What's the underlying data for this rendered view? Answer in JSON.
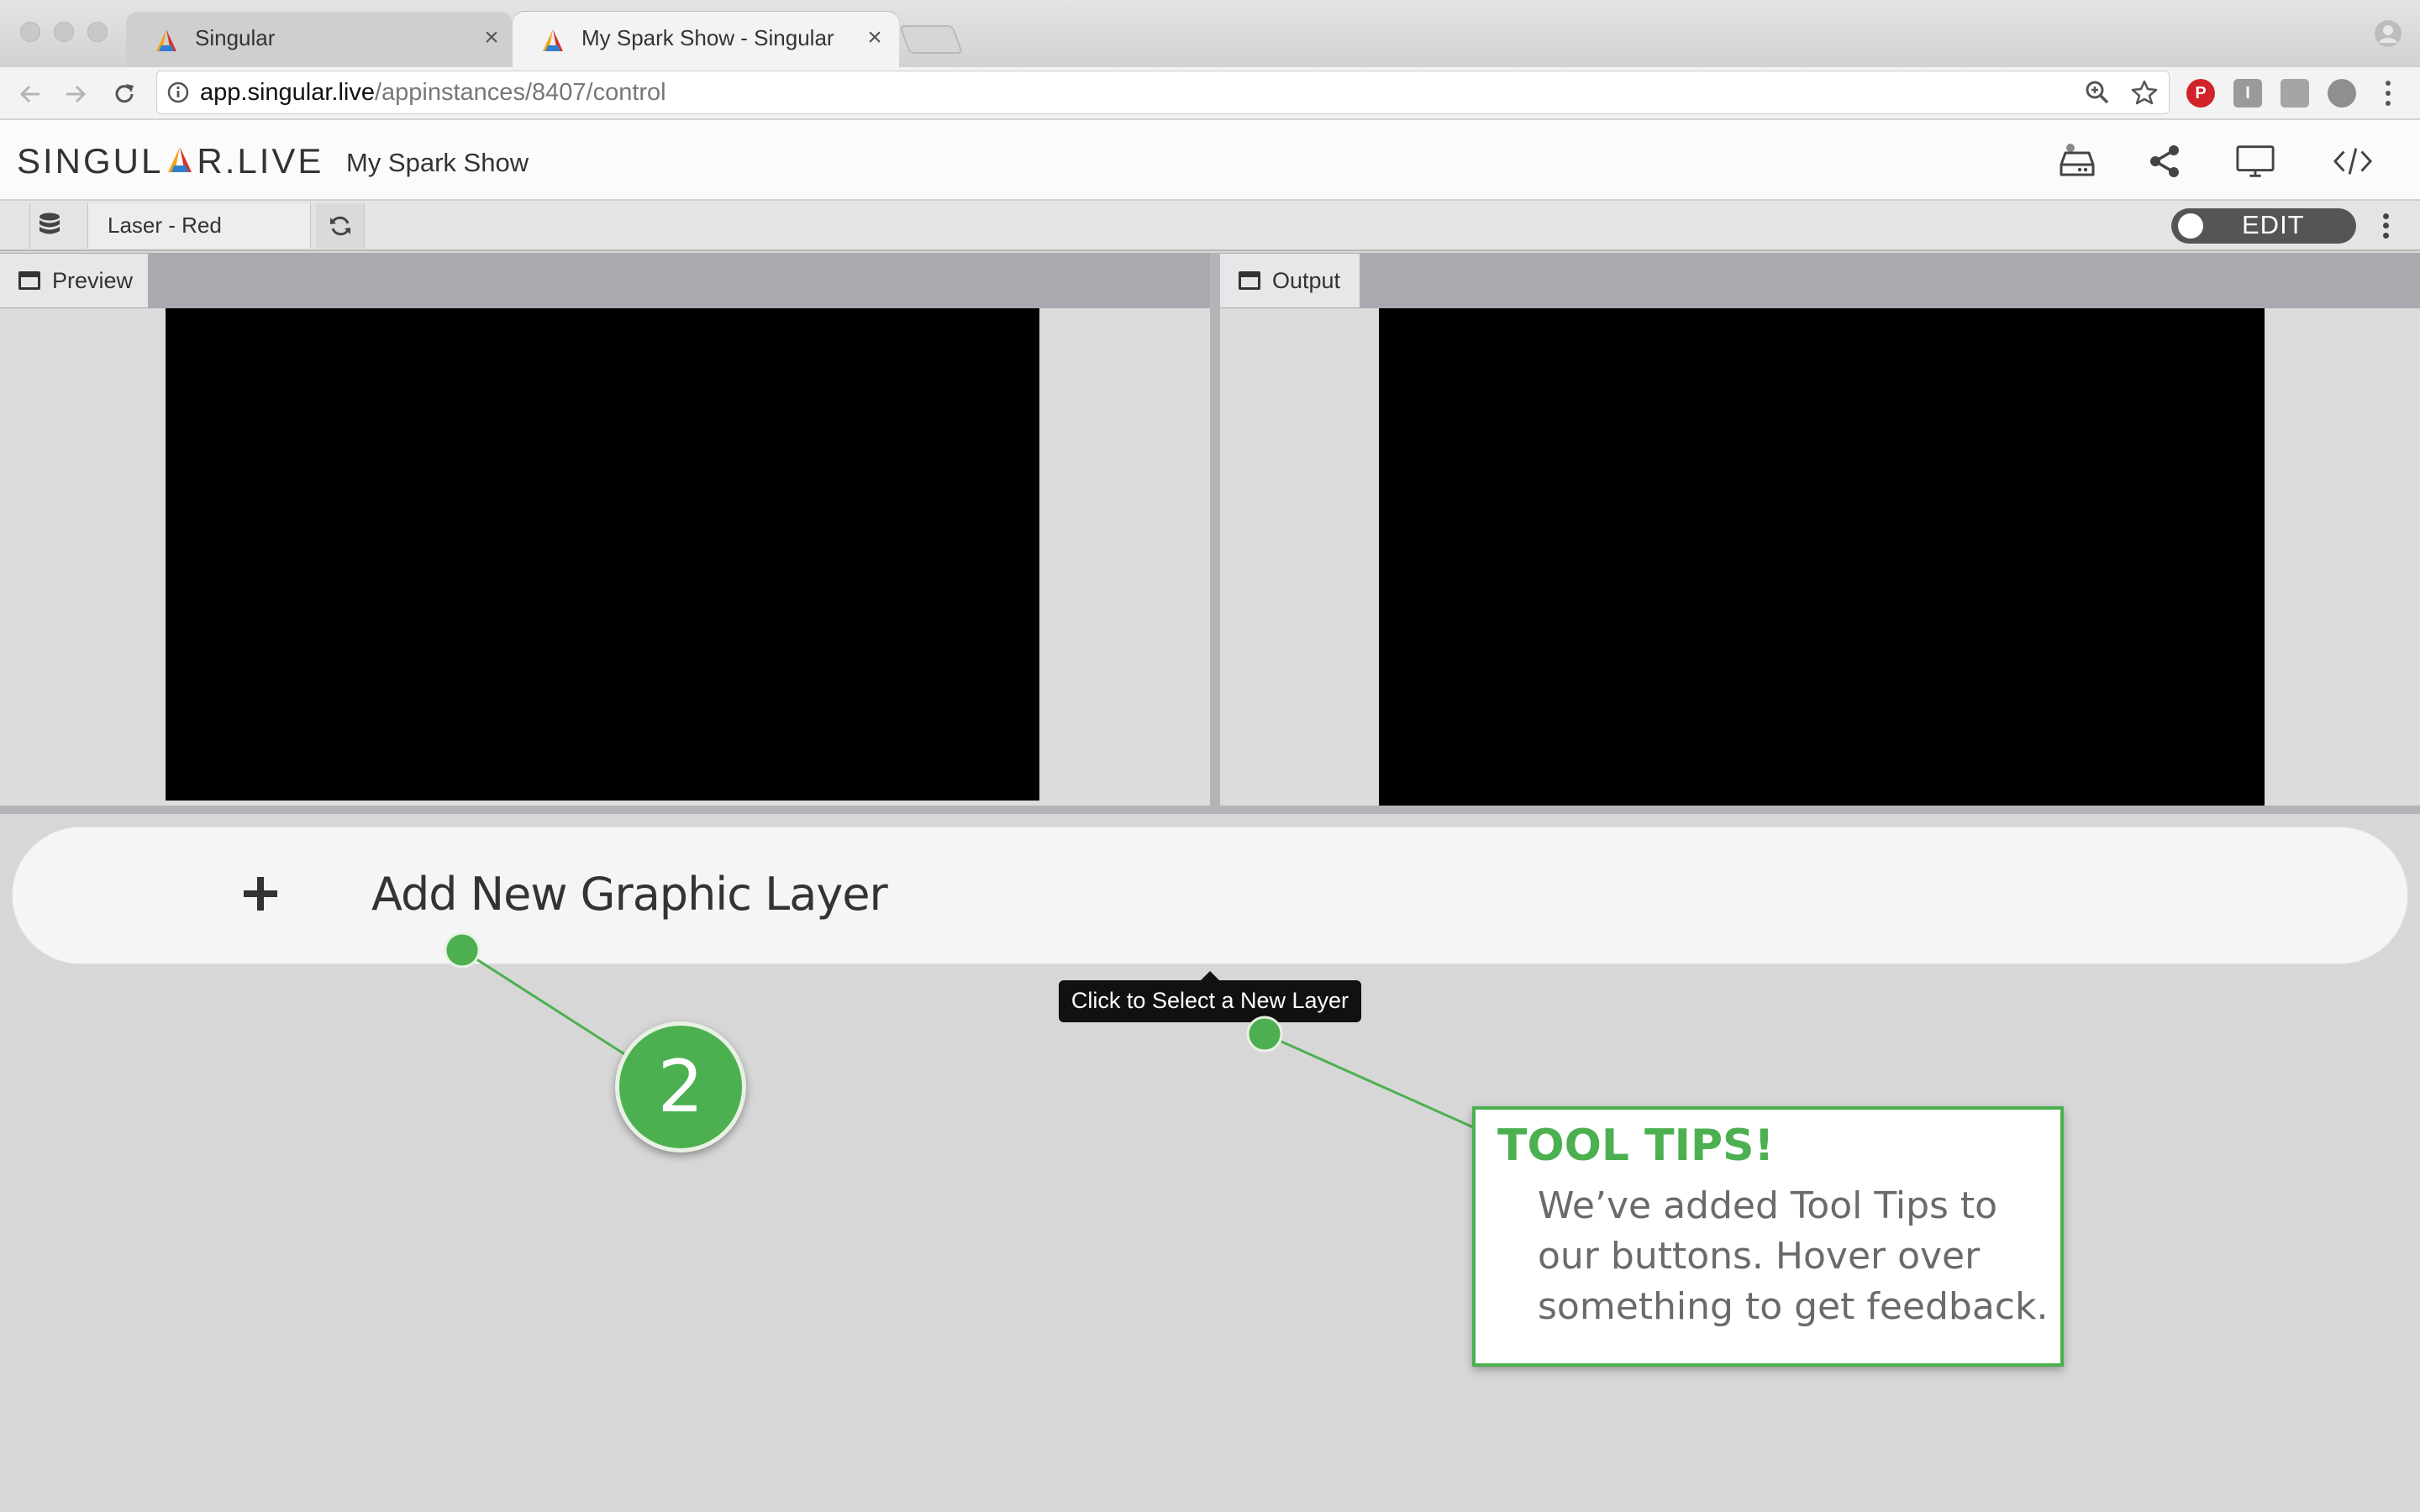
{
  "browser": {
    "tabs": [
      {
        "title": "Singular",
        "active": false
      },
      {
        "title": "My Spark Show - Singular",
        "active": true
      }
    ],
    "address": {
      "host": "app.singular.live",
      "path": "/appinstances/8407/control"
    },
    "extensions": [
      "pinterest-icon",
      "instapaper-icon",
      "extension-icon",
      "profile-extension-icon"
    ]
  },
  "app": {
    "logo_left": "SINGUL",
    "logo_right": "R.LIVE",
    "show_name": "My Spark Show",
    "header_icons": [
      "drive-icon",
      "share-icon",
      "monitor-icon",
      "code-icon"
    ]
  },
  "control_bar": {
    "composition": "Laser - Red",
    "edit_label": "EDIT"
  },
  "panels": {
    "preview_label": "Preview",
    "output_label": "Output"
  },
  "layers": {
    "add_label": "Add New Graphic Layer"
  },
  "tooltip": {
    "text": "Click to Select a New Layer"
  },
  "tutorial": {
    "step_number": "2",
    "tip_title": "TOOL TIPS!",
    "tip_body": "We’ve added Tool Tips to our buttons. Hover over something to get feedback.",
    "accent_color": "#4cb050"
  }
}
